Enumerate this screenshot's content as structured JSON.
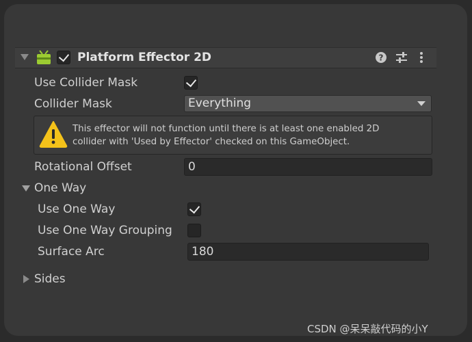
{
  "component": {
    "title": "Platform Effector 2D",
    "enabled": true,
    "icons": [
      "help-icon",
      "preset-icon",
      "more-icon"
    ]
  },
  "fields": {
    "use_collider_mask_label": "Use Collider Mask",
    "use_collider_mask_checked": true,
    "collider_mask_label": "Collider Mask",
    "collider_mask_value": "Everything",
    "warning_line1": "This effector will not function until there is at least one enabled 2D",
    "warning_line2": "collider with 'Used by Effector' checked on this GameObject.",
    "rotational_offset_label": "Rotational Offset",
    "rotational_offset_value": "0"
  },
  "one_way": {
    "section_label": "One Way",
    "expanded": true,
    "use_one_way_label": "Use One Way",
    "use_one_way_checked": true,
    "grouping_label": "Use One Way Grouping",
    "grouping_checked": false,
    "surface_arc_label": "Surface Arc",
    "surface_arc_value": "180"
  },
  "sides": {
    "section_label": "Sides",
    "expanded": false
  },
  "watermark": "CSDN @呆呆敲代码的小Y",
  "colors": {
    "background": "#2b2b2b",
    "panel": "#383838",
    "warning_yellow": "#f4c21a",
    "icon_green": "#9ccc32"
  }
}
